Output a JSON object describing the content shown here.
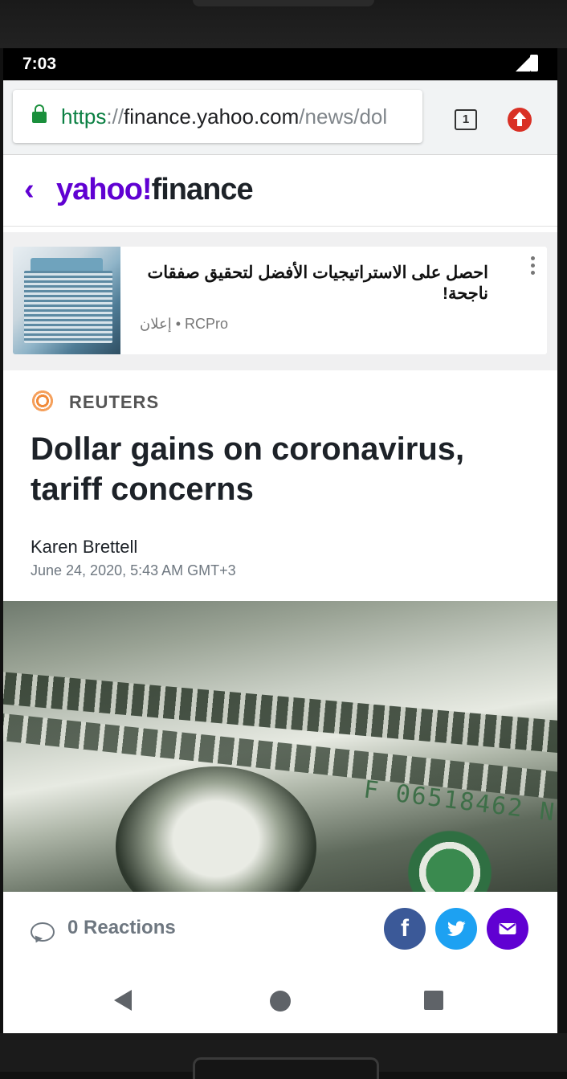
{
  "status_bar": {
    "time": "7:03"
  },
  "browser": {
    "url_scheme": "https",
    "url_sep": "://",
    "url_host": "finance.yahoo.com",
    "url_path": "/news/dol",
    "tab_count": "1"
  },
  "header": {
    "back": "‹",
    "logo_yahoo": "yahoo!",
    "logo_finance": "finance",
    "brand_color": "#6001d2"
  },
  "ad": {
    "title": "احصل على الاستراتيجيات الأفضل لتحقيق صفقات ناجحة!",
    "sponsor": "RCPro",
    "separator": "•",
    "ad_label": "إعلان"
  },
  "article": {
    "source": "REUTERS",
    "headline": "Dollar gains on coronavirus, tariff concerns",
    "author": "Karen Brettell",
    "date": "June 24, 2020, 5:43 AM GMT+3",
    "image_serial": "F 06518462 N"
  },
  "reactions": {
    "label": "0 Reactions",
    "share_facebook": "f"
  },
  "nav": {}
}
